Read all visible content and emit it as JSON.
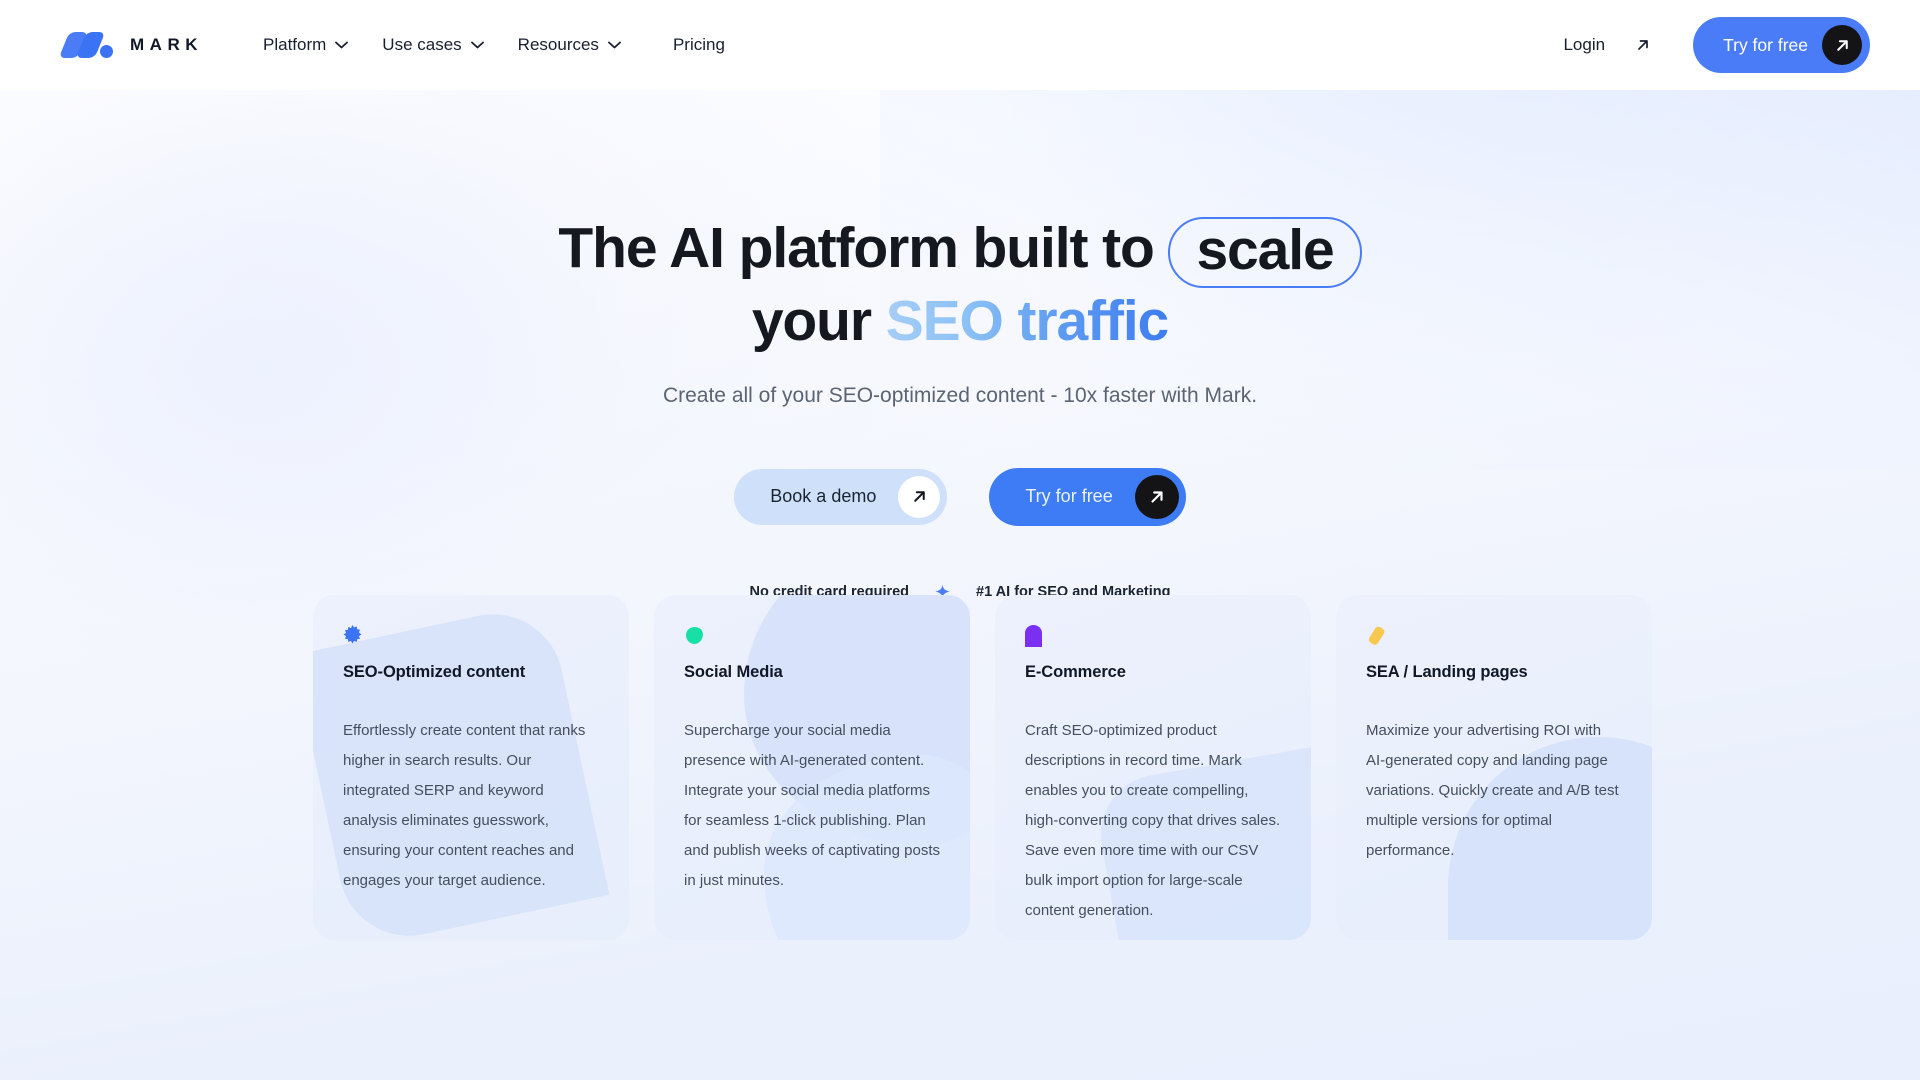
{
  "brand": {
    "name": "MARK",
    "logo_icon": "mark-logo-icon",
    "accent": "#3b73f5"
  },
  "nav": {
    "items": [
      {
        "label": "Platform",
        "has_dropdown": true
      },
      {
        "label": "Use cases",
        "has_dropdown": true
      },
      {
        "label": "Resources",
        "has_dropdown": true
      },
      {
        "label": "Pricing",
        "has_dropdown": false
      }
    ]
  },
  "header_actions": {
    "login_label": "Login",
    "login_icon": "arrow-up-right-icon",
    "try_label": "Try for free",
    "try_icon": "arrow-up-right-icon",
    "try_bg": "#4a7cf7"
  },
  "hero": {
    "headline_part1": "The AI platform built to",
    "headline_pill": "scale",
    "headline_part2": "your",
    "headline_gradient": "SEO traffic",
    "subtitle": "Create all of your SEO-optimized content - 10x faster with Mark.",
    "cta_primary": {
      "label": "Try for free",
      "icon": "arrow-up-right-icon"
    },
    "cta_secondary": {
      "label": "Book a demo",
      "icon": "arrow-up-right-icon"
    },
    "trust_left": "No credit card required",
    "trust_separator_icon": "sparkle-icon",
    "trust_right": "#1 AI for SEO and Marketing"
  },
  "cards": [
    {
      "icon": "starburst-icon",
      "icon_color": "#3b73f5",
      "title": "SEO-Optimized content",
      "body": "Effortlessly create content that ranks higher in search results. Our integrated SERP and keyword analysis eliminates guesswork, ensuring your content reaches and engages your target audience."
    },
    {
      "icon": "teardrop-icon",
      "icon_color": "#16e0a3",
      "title": "Social Media",
      "body": "Supercharge your social media presence with AI-generated content. Integrate your social media platforms for seamless 1-click publishing. Plan and publish weeks of captivating posts in just minutes."
    },
    {
      "icon": "arch-icon",
      "icon_color": "#7b2ff2",
      "title": "E-Commerce",
      "body": "Craft SEO-optimized product descriptions in record time. Mark enables you to create compelling, high-converting copy that drives sales. Save even more time with our CSV bulk import option for large-scale content generation."
    },
    {
      "icon": "tilted-tag-icon",
      "icon_color": "#f8c game",
      "title": "SEA / Landing pages",
      "body": "Maximize your advertising ROI with AI-generated copy and landing page variations. Quickly create and A/B test multiple versions for optimal performance."
    }
  ]
}
